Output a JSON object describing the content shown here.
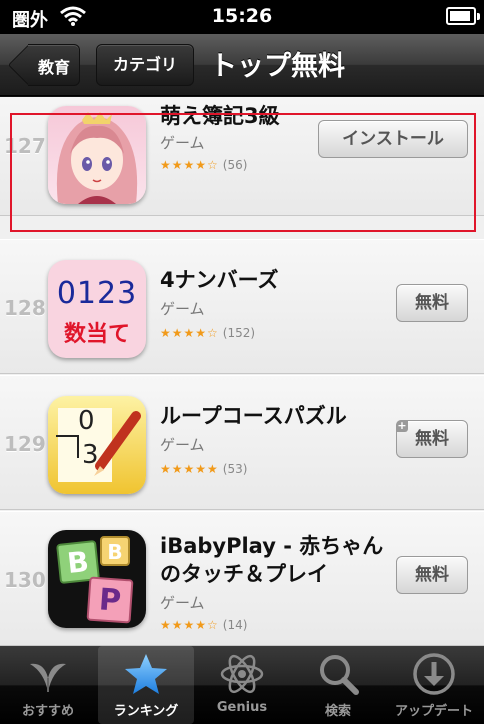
{
  "status_bar": {
    "carrier": "圏外",
    "time": "15:26",
    "battery_level": 0.9
  },
  "nav": {
    "back_label": "教育",
    "category_label": "カテゴリ",
    "title": "トップ無料"
  },
  "apps": [
    {
      "rank": "127",
      "name": "萌え簿記3級",
      "category": "ゲーム",
      "rating": 3.5,
      "stars": "★★★★☆",
      "reviews": "(56)",
      "button": "インストール",
      "icon": "anime-girl-icon"
    },
    {
      "rank": "128",
      "name": "4ナンバーズ",
      "category": "ゲーム",
      "rating": 4,
      "stars": "★★★★☆",
      "reviews": "(152)",
      "button": "無料",
      "icon": "number-game-icon",
      "icon_text_top": "0123",
      "icon_text_bottom": "数当て"
    },
    {
      "rank": "129",
      "name": "ループコースパズル",
      "category": "ゲーム",
      "rating": 4.5,
      "stars": "★★★★★",
      "reviews": "(53)",
      "button": "無料",
      "icon": "loop-puzzle-icon",
      "icon_text_top": "0",
      "icon_text_bottom": "3",
      "plus_badge": "+"
    },
    {
      "rank": "130",
      "name": "iBabyPlay - 赤ちゃんのタッチ＆プレイ",
      "category": "ゲーム",
      "rating": 4,
      "stars": "★★★★☆",
      "reviews": "(14)",
      "button": "無料",
      "icon": "letter-blocks-icon",
      "icon_letters": [
        "B",
        "B",
        "P"
      ]
    }
  ],
  "tabs": [
    {
      "label": "おすすめ",
      "icon": "featured-icon",
      "selected": false
    },
    {
      "label": "ランキング",
      "icon": "star-icon",
      "selected": true
    },
    {
      "label": "Genius",
      "icon": "atom-icon",
      "selected": false
    },
    {
      "label": "検索",
      "icon": "search-icon",
      "selected": false
    },
    {
      "label": "アップデート",
      "icon": "download-icon",
      "selected": false
    }
  ],
  "colors": {
    "highlight": "#e0152a",
    "star": "#f19a1a",
    "tab_selected": "#1e90ff"
  }
}
